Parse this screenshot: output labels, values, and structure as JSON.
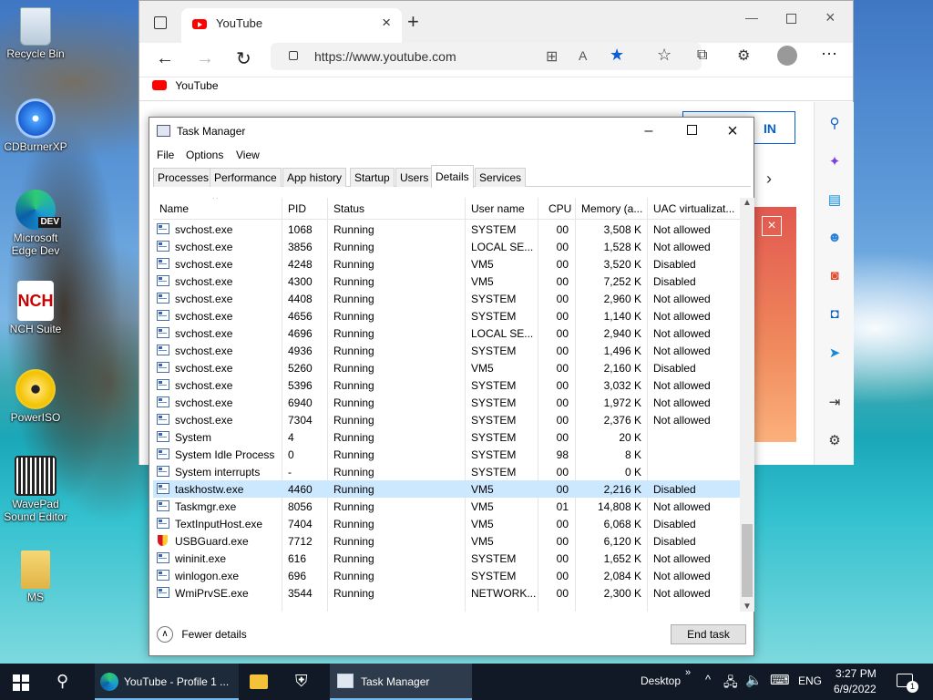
{
  "desktop_icons": [
    {
      "label": "Recycle Bin"
    },
    {
      "label": "CDBurnerXP"
    },
    {
      "label": "Microsoft Edge Dev",
      "badge": "DEV"
    },
    {
      "label": "NCH Suite",
      "badge": "NCH"
    },
    {
      "label": "PowerISO"
    },
    {
      "label": "WavePad Sound Editor"
    },
    {
      "label": "MS"
    }
  ],
  "browser": {
    "tab_title": "YouTube",
    "url": "https://www.youtube.com",
    "bookmark": "YouTube",
    "new_tab_icon": "plus-icon",
    "partial_button": "IN"
  },
  "task_manager": {
    "title": "Task Manager",
    "menu": [
      "File",
      "Options",
      "View"
    ],
    "tabs": [
      "Processes",
      "Performance",
      "App history",
      "Startup",
      "Users",
      "Details",
      "Services"
    ],
    "active_tab": "Details",
    "columns": [
      "Name",
      "PID",
      "Status",
      "User name",
      "CPU",
      "Memory (a...",
      "UAC virtualizat..."
    ],
    "rows": [
      [
        "svchost.exe",
        "1068",
        "Running",
        "SYSTEM",
        "00",
        "3,508 K",
        "Not allowed"
      ],
      [
        "svchost.exe",
        "3856",
        "Running",
        "LOCAL SE...",
        "00",
        "1,528 K",
        "Not allowed"
      ],
      [
        "svchost.exe",
        "4248",
        "Running",
        "VM5",
        "00",
        "3,520 K",
        "Disabled"
      ],
      [
        "svchost.exe",
        "4300",
        "Running",
        "VM5",
        "00",
        "7,252 K",
        "Disabled"
      ],
      [
        "svchost.exe",
        "4408",
        "Running",
        "SYSTEM",
        "00",
        "2,960 K",
        "Not allowed"
      ],
      [
        "svchost.exe",
        "4656",
        "Running",
        "SYSTEM",
        "00",
        "1,140 K",
        "Not allowed"
      ],
      [
        "svchost.exe",
        "4696",
        "Running",
        "LOCAL SE...",
        "00",
        "2,940 K",
        "Not allowed"
      ],
      [
        "svchost.exe",
        "4936",
        "Running",
        "SYSTEM",
        "00",
        "1,496 K",
        "Not allowed"
      ],
      [
        "svchost.exe",
        "5260",
        "Running",
        "VM5",
        "00",
        "2,160 K",
        "Disabled"
      ],
      [
        "svchost.exe",
        "5396",
        "Running",
        "SYSTEM",
        "00",
        "3,032 K",
        "Not allowed"
      ],
      [
        "svchost.exe",
        "6940",
        "Running",
        "SYSTEM",
        "00",
        "1,972 K",
        "Not allowed"
      ],
      [
        "svchost.exe",
        "7304",
        "Running",
        "SYSTEM",
        "00",
        "2,376 K",
        "Not allowed"
      ],
      [
        "System",
        "4",
        "Running",
        "SYSTEM",
        "00",
        "20 K",
        ""
      ],
      [
        "System Idle Process",
        "0",
        "Running",
        "SYSTEM",
        "98",
        "8 K",
        ""
      ],
      [
        "System interrupts",
        "-",
        "Running",
        "SYSTEM",
        "00",
        "0 K",
        ""
      ],
      [
        "taskhostw.exe",
        "4460",
        "Running",
        "VM5",
        "00",
        "2,216 K",
        "Disabled"
      ],
      [
        "Taskmgr.exe",
        "8056",
        "Running",
        "VM5",
        "01",
        "14,808 K",
        "Not allowed"
      ],
      [
        "TextInputHost.exe",
        "7404",
        "Running",
        "VM5",
        "00",
        "6,068 K",
        "Disabled"
      ],
      [
        "USBGuard.exe",
        "7712",
        "Running",
        "VM5",
        "00",
        "6,120 K",
        "Disabled"
      ],
      [
        "wininit.exe",
        "616",
        "Running",
        "SYSTEM",
        "00",
        "1,652 K",
        "Not allowed"
      ],
      [
        "winlogon.exe",
        "696",
        "Running",
        "SYSTEM",
        "00",
        "2,084 K",
        "Not allowed"
      ],
      [
        "WmiPrvSE.exe",
        "3544",
        "Running",
        "NETWORK...",
        "00",
        "2,300 K",
        "Not allowed"
      ]
    ],
    "selected_row": 15,
    "fewer_details": "Fewer details",
    "end_task": "End task"
  },
  "taskbar": {
    "items": [
      "YouTube - Profile 1 ...",
      "Task Manager"
    ],
    "desktop_label": "Desktop",
    "language": "ENG",
    "time": "3:27 PM",
    "date": "6/9/2022",
    "notification_count": "1"
  },
  "colors": {
    "accent": "#0078d7",
    "selection": "#cce8ff",
    "taskbar": "#101925"
  }
}
